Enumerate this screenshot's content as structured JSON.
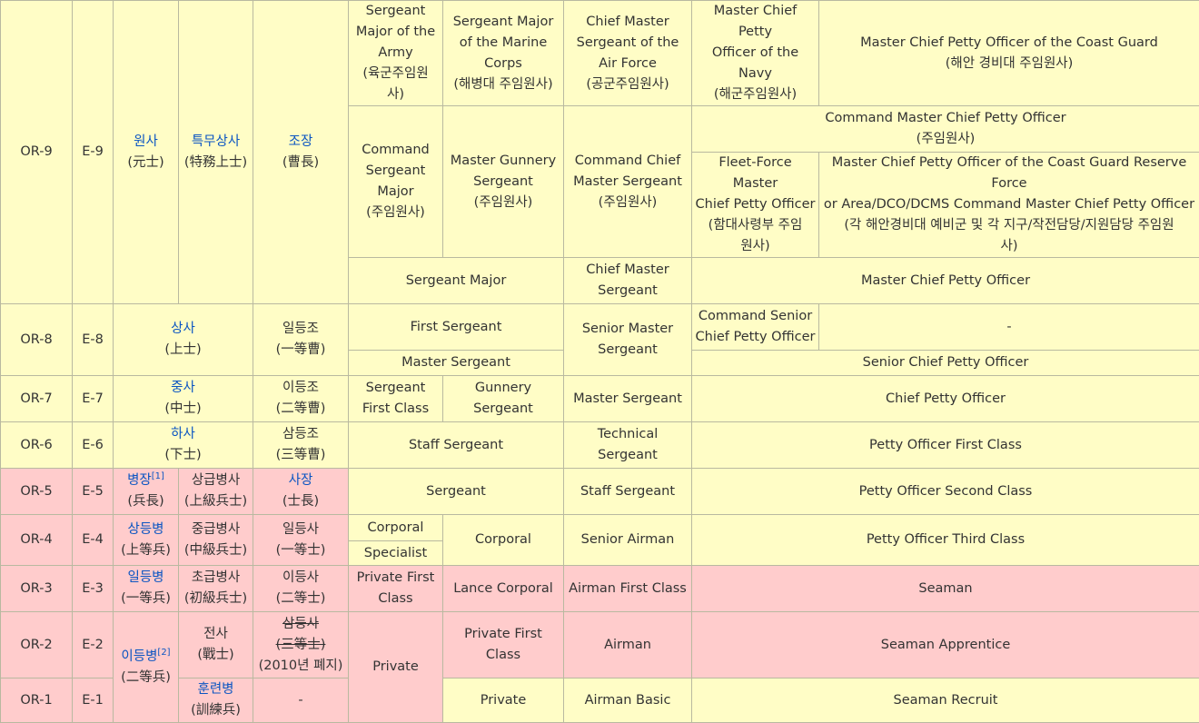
{
  "rows": {
    "e9": {
      "or": "OR-9",
      "e": "E-9",
      "wonsa": "원사",
      "wonsa_h": "(元士)",
      "tms": "특무상사",
      "tms_h": "(特務上士)",
      "jojang": "조장",
      "jojang_h": "(曹長)",
      "sma": [
        "Sergeant",
        "Major of the",
        "Army",
        "(육군주임원",
        "사)"
      ],
      "smmc": [
        "Sergeant Major",
        "of the Marine",
        "Corps",
        "(해병대 주임원사)"
      ],
      "cmsaf": [
        "Chief Master",
        "Sergeant of the",
        "Air Force",
        "(공군주임원사)"
      ],
      "mcpon": [
        "Master Chief Petty",
        "Officer of the",
        "Navy",
        "(해군주임원사)"
      ],
      "mcpocg": [
        "Master Chief Petty Officer of the Coast Guard",
        "(해안 경비대 주임원사)"
      ],
      "csm": [
        "Command",
        "Sergeant",
        "Major",
        "(주임원사)"
      ],
      "mgs": [
        "Master Gunnery",
        "Sergeant",
        "(주임원사)"
      ],
      "ccms": [
        "Command Chief",
        "Master Sergeant",
        "(주임원사)"
      ],
      "cmcpo": [
        "Command Master Chief Petty Officer",
        "(주임원사)"
      ],
      "fleet": [
        "Fleet-Force Master",
        "Chief Petty Officer",
        "(함대사령부 주임",
        "원사)"
      ],
      "mcpocgr": [
        "Master Chief Petty Officer of the Coast Guard Reserve Force",
        "or Area/DCO/DCMS Command Master Chief Petty Officer",
        "(각 해안경비대 예비군 및 각 지구/작전담당/지원담당 주임원",
        "사)"
      ],
      "sm": "Sergeant Major",
      "cms": [
        "Chief Master",
        "Sergeant"
      ],
      "mcpo": "Master Chief Petty Officer"
    },
    "e8": {
      "or": "OR-8",
      "e": "E-8",
      "sangsa": "상사",
      "sangsa_h": "(上士)",
      "ildeungjo": "일등조",
      "ildeungjo_h": "(一等曹)",
      "fsg": "First Sergeant",
      "smsgt": [
        "Senior Master",
        "Sergeant"
      ],
      "cscpo": [
        "Command Senior",
        "Chief Petty Officer"
      ],
      "dash": "-",
      "msg": "Master Sergeant",
      "scpo": "Senior Chief Petty Officer"
    },
    "e7": {
      "or": "OR-7",
      "e": "E-7",
      "jungsa": "중사",
      "jungsa_h": "(中士)",
      "ideungjo": "이등조",
      "ideungjo_h": "(二等曹)",
      "sfc": [
        "Sergeant",
        "First Class"
      ],
      "gysgt": [
        "Gunnery",
        "Sergeant"
      ],
      "msgt": "Master Sergeant",
      "cpo": "Chief Petty Officer"
    },
    "e6": {
      "or": "OR-6",
      "e": "E-6",
      "hasa": "하사",
      "hasa_h": "(下士)",
      "samdeungjo": "삼등조",
      "samdeungjo_h": "(三等曹)",
      "ssg": "Staff Sergeant",
      "tsgt": "Technical Sergeant",
      "po1": "Petty Officer First Class"
    },
    "e5": {
      "or": "OR-5",
      "e": "E-5",
      "byeongjang": "병장",
      "byeongjang_sup": "[1]",
      "byeongjang_h": "(兵長)",
      "sanggeup": "상급병사",
      "sanggeup_h": "(上級兵士)",
      "sajang": "사장",
      "sajang_h": "(士長)",
      "sgt": "Sergeant",
      "ssgt": "Staff Sergeant",
      "po2": "Petty Officer Second Class"
    },
    "e4": {
      "or": "OR-4",
      "e": "E-4",
      "sangdeung": "상등병",
      "sangdeung_h": "(上等兵)",
      "junggeup": "중급병사",
      "junggeup_h": "(中級兵士)",
      "ildeungsa": "일등사",
      "ildeungsa_h": "(一等士)",
      "cpl": "Corporal",
      "spc": "Specialist",
      "cpl_mc": "Corporal",
      "sra": "Senior Airman",
      "po3": "Petty Officer Third Class"
    },
    "e3": {
      "or": "OR-3",
      "e": "E-3",
      "ildeungbyeong": "일등병",
      "ildeungbyeong_h": "(一等兵)",
      "chogeup": "초급병사",
      "chogeup_h": "(初級兵士)",
      "ideungsa": "이등사",
      "ideungsa_h": "(二等士)",
      "pfc": [
        "Private First",
        "Class"
      ],
      "lcpl": "Lance Corporal",
      "a1c": "Airman First Class",
      "sn": "Seaman"
    },
    "e2": {
      "or": "OR-2",
      "e": "E-2",
      "ideungbyeong": "이등병",
      "ideungbyeong_sup": "[2]",
      "ideungbyeong_h": "(二等兵)",
      "jeonsa": "전사",
      "jeonsa_h": "(戰士)",
      "samdeungsa": "삼등사",
      "samdeungsa_h": "(三等士)",
      "abolished": "(2010년 폐지)",
      "pvt": "Private",
      "pfc_mc": "Private First Class",
      "amn": "Airman",
      "sa": "Seaman Apprentice"
    },
    "e1": {
      "or": "OR-1",
      "e": "E-1",
      "hullyeon": "훈련병",
      "hullyeon_h": "(訓練兵)",
      "dash": "-",
      "pvt_mc": "Private",
      "ab": "Airman Basic",
      "sr": "Seaman Recruit"
    }
  }
}
